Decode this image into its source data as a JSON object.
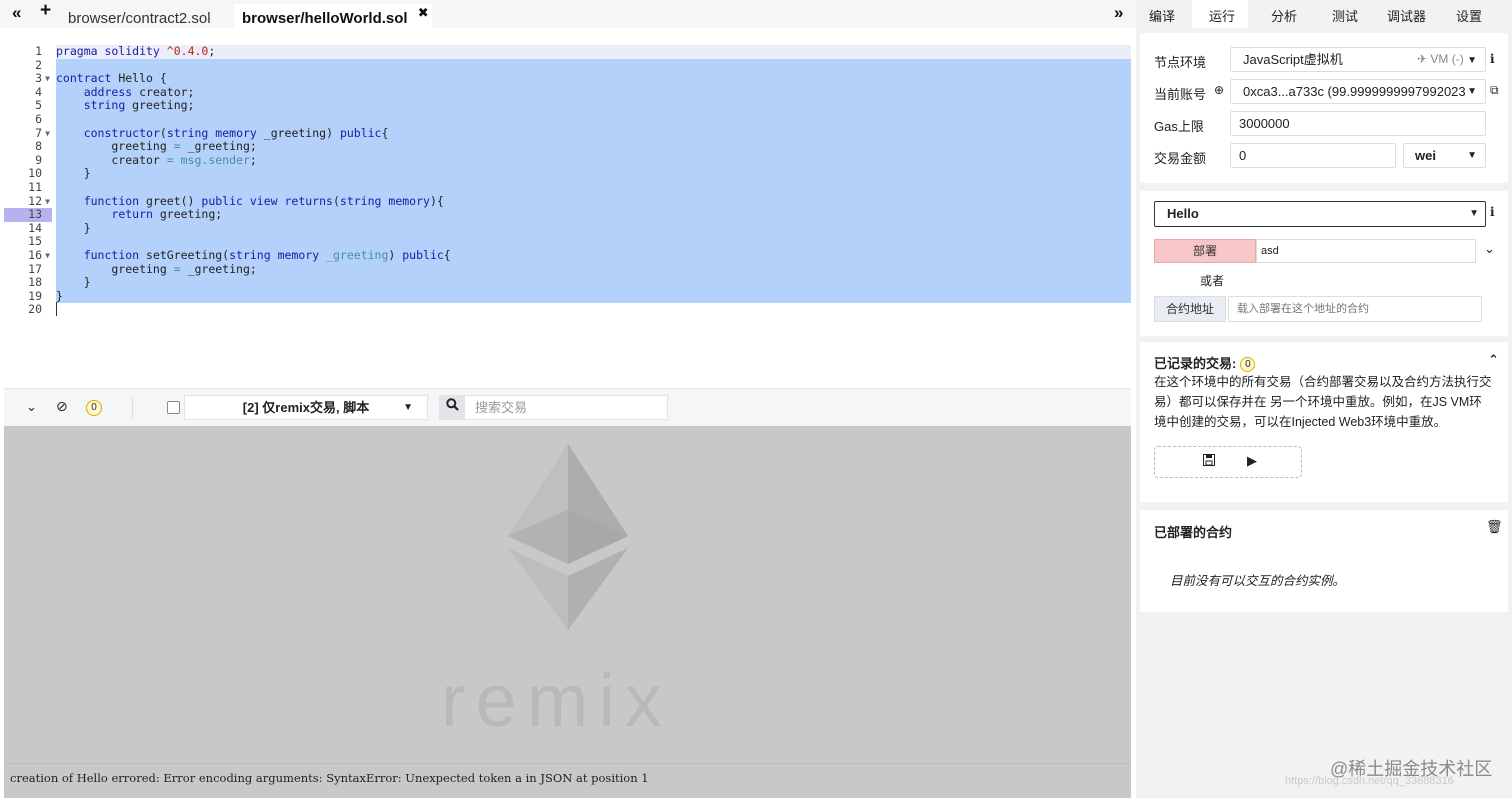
{
  "tabs": {
    "collapse_left_icon": "«",
    "new_file_icon": "+",
    "files": [
      {
        "label": "browser/contract2.sol"
      },
      {
        "label": "browser/helloWorld.sol",
        "close": "✖"
      }
    ],
    "collapse_right_icon": "»"
  },
  "editor": {
    "line_numbers": [
      "1",
      "2",
      "3",
      "4",
      "5",
      "6",
      "7",
      "8",
      "9",
      "10",
      "11",
      "12",
      "13",
      "14",
      "15",
      "16",
      "17",
      "18",
      "19",
      "20"
    ],
    "current_line": 13
  },
  "terminal_bar": {
    "pending_count": "0",
    "filter_label": "[2] 仅remix交易, 脚本",
    "search_placeholder": "搜索交易"
  },
  "terminal": {
    "watermark_word": "remix",
    "log_line": "creation of Hello errored: Error encoding arguments: SyntaxError: Unexpected token a in JSON at position 1"
  },
  "right_tabs": [
    "编译",
    "运行",
    "分析",
    "测试",
    "调试器",
    "设置"
  ],
  "run": {
    "environment_label": "节点环境",
    "environment_value": "JavaScript虚拟机",
    "environment_badge": "VM (-)",
    "account_label": "当前账号",
    "account_value": "0xca3...a733c (99.9999999997992023",
    "gas_label": "Gas上限",
    "gas_value": "3000000",
    "value_label": "交易金额",
    "value_value": "0",
    "value_unit": "wei"
  },
  "deploy": {
    "contract": "Hello",
    "deploy_label": "部署",
    "deploy_args": "asd",
    "or_label": "或者",
    "at_address_label": "合约地址",
    "at_address_placeholder": "载入部署在这个地址的合约"
  },
  "recorded": {
    "title": "已记录的交易:",
    "count": "0",
    "description": "在这个环境中的所有交易（合约部署交易以及合约方法执行交易）都可以保存并在 另一个环境中重放。例如，在JS VM环境中创建的交易，可以在Injected Web3环境中重放。"
  },
  "deployed": {
    "title": "已部署的合约",
    "empty_message": "目前没有可以交互的合约实例。"
  },
  "watermark": {
    "text": "@稀土掘金技术社区",
    "url_text": "https://blog.csdn.net/qq_33688316"
  }
}
